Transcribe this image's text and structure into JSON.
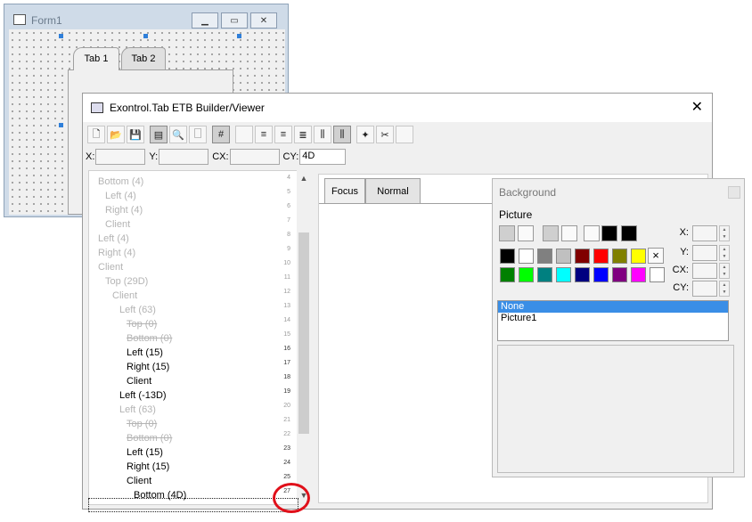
{
  "form1": {
    "title": "Form1",
    "tabs": [
      "Tab 1",
      "Tab 2"
    ]
  },
  "builder": {
    "title": "Exontrol.Tab ETB Builder/Viewer",
    "coords": {
      "x_label": "X:",
      "y_label": "Y:",
      "cx_label": "CX:",
      "cy_label": "CY:",
      "cy_value": "4D"
    },
    "tree": [
      {
        "label": "Bottom (4)",
        "line": "4",
        "indent": 0,
        "style": "dim"
      },
      {
        "label": "Left (4)",
        "line": "5",
        "indent": 1,
        "style": "dim"
      },
      {
        "label": "Right (4)",
        "line": "6",
        "indent": 1,
        "style": "dim"
      },
      {
        "label": "Client",
        "line": "7",
        "indent": 1,
        "style": "dim"
      },
      {
        "label": "Left (4)",
        "line": "8",
        "indent": 0,
        "style": "dim"
      },
      {
        "label": "Right (4)",
        "line": "9",
        "indent": 0,
        "style": "dim"
      },
      {
        "label": "Client",
        "line": "10",
        "indent": 0,
        "style": "dim"
      },
      {
        "label": "Top (29D)",
        "line": "11",
        "indent": 1,
        "style": "dim"
      },
      {
        "label": "Client",
        "line": "12",
        "indent": 2,
        "style": "dim"
      },
      {
        "label": "Left (63)",
        "line": "13",
        "indent": 3,
        "style": "dim"
      },
      {
        "label": "Top (0)",
        "line": "14",
        "indent": 4,
        "style": "struck"
      },
      {
        "label": "Bottom (0)",
        "line": "15",
        "indent": 4,
        "style": "struck"
      },
      {
        "label": "Left (15)",
        "line": "16",
        "indent": 4,
        "style": "normal"
      },
      {
        "label": "Right (15)",
        "line": "17",
        "indent": 4,
        "style": "normal"
      },
      {
        "label": "Client",
        "line": "18",
        "indent": 4,
        "style": "normal"
      },
      {
        "label": "Left (-13D)",
        "line": "19",
        "indent": 3,
        "style": "normal"
      },
      {
        "label": "Left (63)",
        "line": "20",
        "indent": 3,
        "style": "dim"
      },
      {
        "label": "Top (0)",
        "line": "21",
        "indent": 4,
        "style": "struck"
      },
      {
        "label": "Bottom (0)",
        "line": "22",
        "indent": 4,
        "style": "struck"
      },
      {
        "label": "Left (15)",
        "line": "23",
        "indent": 4,
        "style": "normal"
      },
      {
        "label": "Right (15)",
        "line": "24",
        "indent": 4,
        "style": "normal"
      },
      {
        "label": "Client",
        "line": "25",
        "indent": 4,
        "style": "normal"
      },
      {
        "label": "Bottom (4D)",
        "line": "27",
        "indent": 5,
        "style": "normal"
      }
    ],
    "preview_tabs": [
      "Focus",
      "Normal"
    ]
  },
  "background_panel": {
    "title": "Background",
    "section": "Picture",
    "swatches_row1": [
      "#000000",
      "#ffffff",
      "#808080",
      "#c0c0c0",
      "#800000",
      "#ff0000",
      "#808000",
      "#ffff00"
    ],
    "swatches_row2": [
      "#008000",
      "#00ff00",
      "#008080",
      "#00ffff",
      "#000080",
      "#0000ff",
      "#800080",
      "#ff00ff",
      "#ffffff"
    ],
    "clear_label": "×",
    "labels": {
      "x": "X:",
      "y": "Y:",
      "cx": "CX:",
      "cy": "CY:"
    },
    "pictures": [
      "None",
      "Picture1"
    ],
    "selected": "None"
  }
}
